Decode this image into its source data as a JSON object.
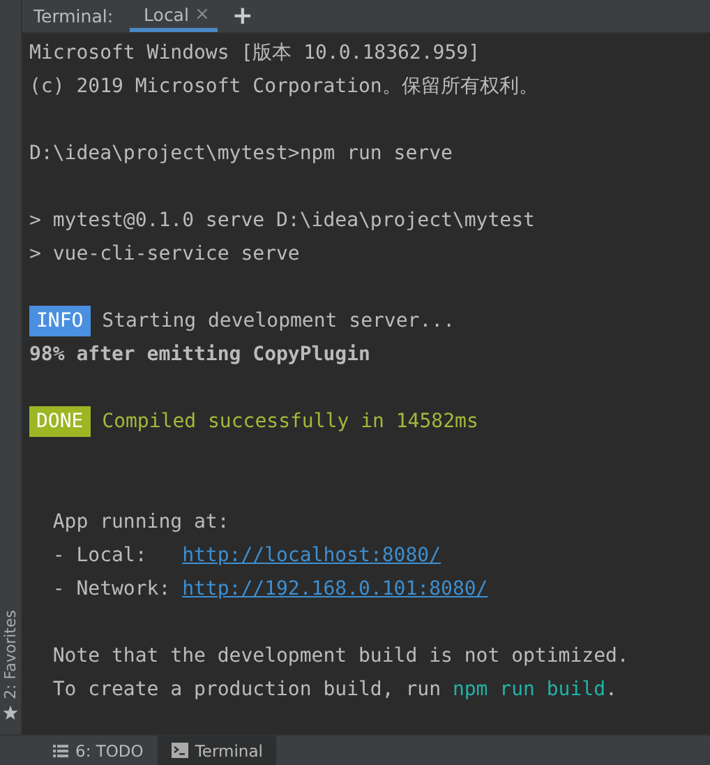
{
  "tab_bar": {
    "label": "Terminal:",
    "tabs": [
      {
        "label": "Local",
        "selected": true,
        "close": "×"
      }
    ],
    "add": "+"
  },
  "terminal_lines": [
    {
      "segments": [
        {
          "kind": "plain",
          "text": "Microsoft Windows [版本 10.0.18362.959]"
        }
      ]
    },
    {
      "segments": [
        {
          "kind": "plain",
          "text": "(c) 2019 Microsoft Corporation。保留所有权利。"
        }
      ]
    },
    {
      "kind": "blank"
    },
    {
      "segments": [
        {
          "kind": "plain",
          "text": "D:\\idea\\project\\mytest>npm run serve"
        }
      ]
    },
    {
      "kind": "blank"
    },
    {
      "segments": [
        {
          "kind": "plain",
          "text": "> mytest@0.1.0 serve D:\\idea\\project\\mytest"
        }
      ]
    },
    {
      "segments": [
        {
          "kind": "plain",
          "text": "> vue-cli-service serve"
        }
      ]
    },
    {
      "kind": "blank"
    },
    {
      "segments": [
        {
          "kind": "badge",
          "text": "INFO",
          "color": "#4a8fe0"
        },
        {
          "kind": "plain",
          "text": " Starting development server..."
        }
      ]
    },
    {
      "segments": [
        {
          "kind": "bold",
          "text": "98% after emitting CopyPlugin"
        }
      ]
    },
    {
      "kind": "blank"
    },
    {
      "segments": [
        {
          "kind": "badge",
          "text": "DONE",
          "color": "#9cb624"
        },
        {
          "kind": "success",
          "text": " Compiled successfully in 14582ms"
        }
      ]
    },
    {
      "kind": "blank"
    },
    {
      "kind": "blank"
    },
    {
      "segments": [
        {
          "kind": "plain",
          "text": "  App running at:"
        }
      ]
    },
    {
      "segments": [
        {
          "kind": "plain",
          "text": "  - Local:   "
        },
        {
          "kind": "link",
          "text": "http://localhost:8080/"
        }
      ]
    },
    {
      "segments": [
        {
          "kind": "plain",
          "text": "  - Network: "
        },
        {
          "kind": "link",
          "text": "http://192.168.0.101:8080/"
        }
      ]
    },
    {
      "kind": "blank"
    },
    {
      "segments": [
        {
          "kind": "plain",
          "text": "  Note that the development build is not optimized."
        }
      ]
    },
    {
      "segments": [
        {
          "kind": "plain",
          "text": "  To create a production build, run "
        },
        {
          "kind": "command",
          "text": "npm run build"
        },
        {
          "kind": "plain",
          "text": "."
        }
      ]
    }
  ],
  "side_strip": {
    "label": "2: Favorites"
  },
  "bottom_bar": {
    "tabs": [
      {
        "kind": "todo",
        "label": "6: TODO",
        "selected": false
      },
      {
        "kind": "terminal",
        "label": "Terminal",
        "selected": true
      }
    ]
  }
}
